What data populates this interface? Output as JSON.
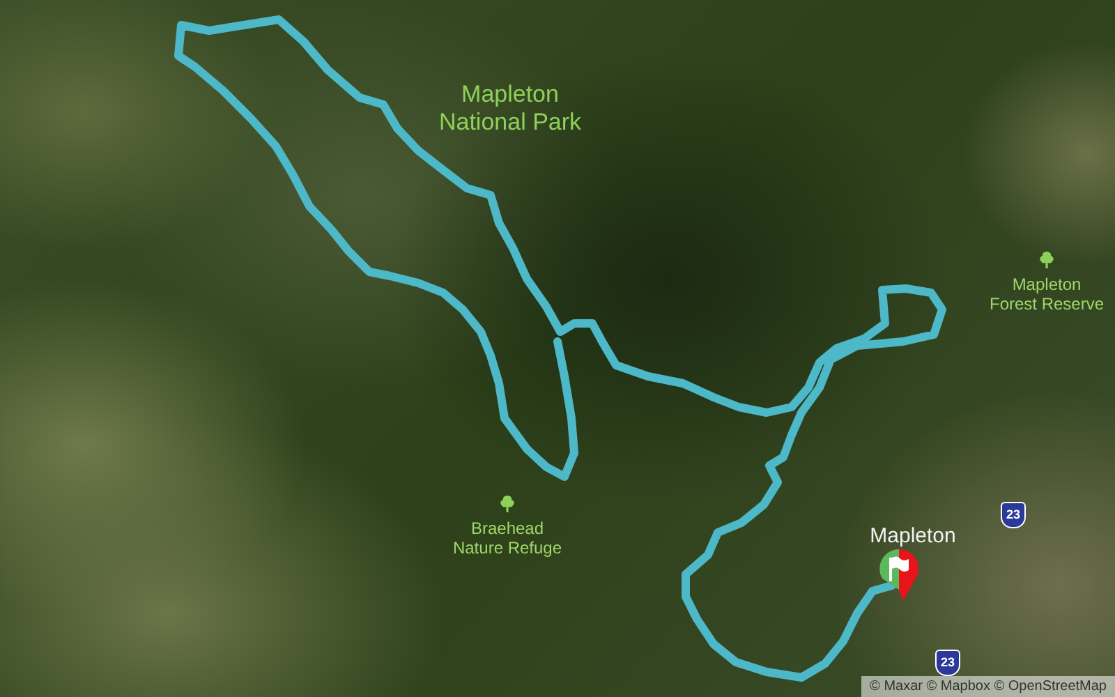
{
  "map": {
    "labels": [
      {
        "kind": "park",
        "name": "Mapleton National Park"
      },
      {
        "kind": "reserve",
        "name": "Mapleton Forest Reserve"
      },
      {
        "kind": "reserve",
        "name": "Braehead Nature Refuge"
      },
      {
        "kind": "town",
        "name": "Mapleton"
      }
    ],
    "shields": [
      "23",
      "23"
    ],
    "attribution": "© Maxar © Mapbox © OpenStreetMap"
  }
}
